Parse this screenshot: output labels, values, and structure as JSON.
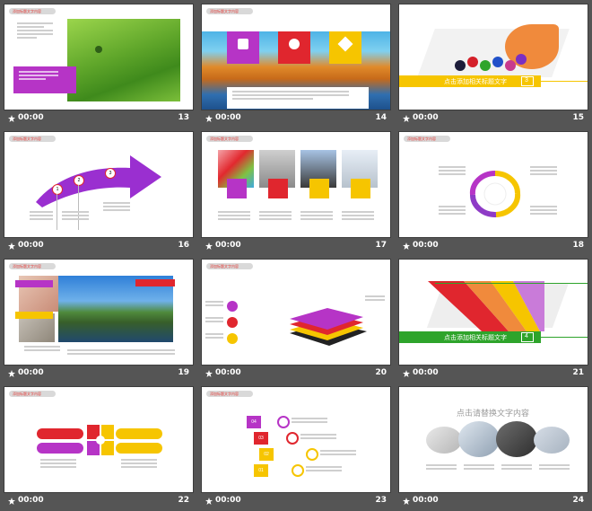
{
  "slides": [
    {
      "num": "13",
      "time": "00:00",
      "tag": "添加标题文字内容"
    },
    {
      "num": "14",
      "time": "00:00",
      "tag": "添加标题文字内容"
    },
    {
      "num": "15",
      "time": "00:00",
      "banner": "点击添加相关标题文字",
      "banner_num": "3"
    },
    {
      "num": "16",
      "time": "00:00",
      "tag": "添加标题文字内容",
      "steps": [
        "1",
        "2",
        "3"
      ]
    },
    {
      "num": "17",
      "time": "00:00",
      "tag": "添加标题文字内容"
    },
    {
      "num": "18",
      "time": "00:00",
      "tag": "添加标题文字内容"
    },
    {
      "num": "19",
      "time": "00:00",
      "tag": "添加标题文字内容"
    },
    {
      "num": "20",
      "time": "00:00",
      "tag": "添加标题文字内容"
    },
    {
      "num": "21",
      "time": "00:00",
      "banner": "点击添加相关标题文字",
      "banner_num": "4"
    },
    {
      "num": "22",
      "time": "00:00",
      "tag": "添加标题文字内容"
    },
    {
      "num": "23",
      "time": "00:00",
      "tag": "添加标题文字内容",
      "boxes": [
        "01",
        "02",
        "03",
        "04"
      ]
    },
    {
      "num": "24",
      "time": "00:00",
      "title": "点击请替换文字内容"
    }
  ],
  "colors": {
    "background": "#555555",
    "purple": "#b634c6",
    "red": "#e0262e",
    "yellow": "#f6c500",
    "green": "#2ea42b",
    "caption": "#ffffff"
  },
  "icons": {
    "caption": "star-icon"
  }
}
